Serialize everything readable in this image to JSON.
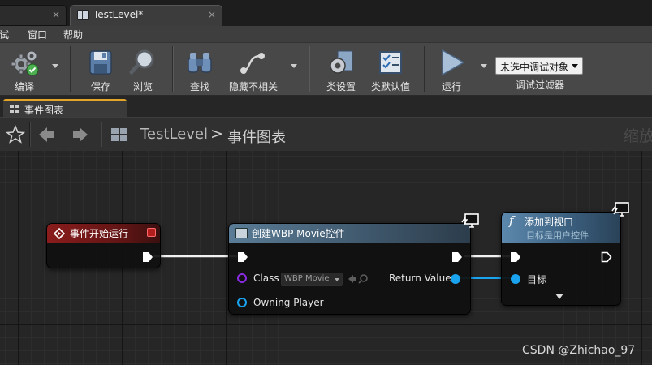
{
  "tabs": [
    {
      "label": "",
      "close": "×"
    },
    {
      "label": "TestLevel*",
      "close": "×"
    }
  ],
  "menu": [
    "试",
    "窗口",
    "帮助"
  ],
  "toolbar": {
    "compile": "编译",
    "save": "保存",
    "browse": "浏览",
    "find": "查找",
    "hide_unrelated": "隐藏不相关",
    "class_settings": "类设置",
    "class_defaults": "类默认值",
    "run": "运行",
    "debug_object": "未选中调试对象",
    "debug_filter": "调试过滤器"
  },
  "panel_tab": "事件图表",
  "breadcrumb": {
    "level": "TestLevel",
    "separator": ">",
    "graph": "事件图表"
  },
  "zoom_text": "缩放",
  "nodes": {
    "begin_play": {
      "title": "事件开始运行"
    },
    "create_widget": {
      "title": "创建WBP Movie控件",
      "class_label": "Class",
      "class_value": "WBP Movie",
      "owning_player": "Owning Player",
      "return_value": "Return Value"
    },
    "add_to_viewport": {
      "glyph": "f",
      "title": "添加到视口",
      "subtitle": "目标是用户控件",
      "target": "目标"
    }
  },
  "colors": {
    "event_header": "#8a1c1c",
    "call_header": "#4e6c83",
    "object_pin": "#1aa3ee",
    "class_pin": "#8a2be2",
    "exec": "#ffffff",
    "panel_accent": "#e4a528"
  },
  "watermark": "CSDN @Zhichao_97"
}
